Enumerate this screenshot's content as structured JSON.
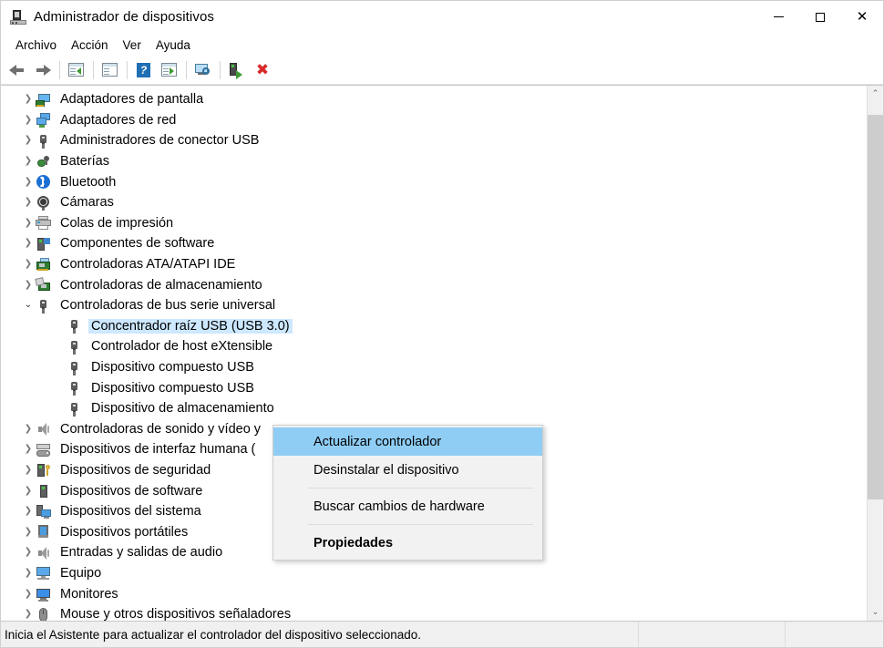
{
  "window": {
    "title": "Administrador de dispositivos",
    "icon": "device-manager-icon",
    "controls": {
      "minimize": "—",
      "maximize": "▢",
      "close": "✕"
    }
  },
  "menubar": {
    "items": [
      {
        "label": "Archivo",
        "name": "menu-archivo"
      },
      {
        "label": "Acción",
        "name": "menu-accion"
      },
      {
        "label": "Ver",
        "name": "menu-ver"
      },
      {
        "label": "Ayuda",
        "name": "menu-ayuda"
      }
    ]
  },
  "toolbar": {
    "buttons": [
      {
        "name": "back-button",
        "icon": "back-arrow-icon"
      },
      {
        "name": "forward-button",
        "icon": "forward-arrow-icon"
      },
      {
        "name": "show-hide-console-tree-button",
        "icon": "console-tree-icon"
      },
      {
        "name": "properties-button",
        "icon": "properties-window-icon"
      },
      {
        "name": "help-button",
        "icon": "help-question-icon"
      },
      {
        "name": "update-driver-button",
        "icon": "update-driver-icon"
      },
      {
        "name": "scan-hardware-changes-button",
        "icon": "scan-monitor-icon"
      },
      {
        "name": "uninstall-device-button",
        "icon": "uninstall-device-icon"
      },
      {
        "name": "disable-device-button",
        "icon": "red-x-icon"
      }
    ]
  },
  "tree": {
    "rows": [
      {
        "label": "Adaptadores de pantalla",
        "level": 1,
        "chevron": "collapsed",
        "icon": "display-adapter-icon",
        "icon_class": "i-disp",
        "selected": false
      },
      {
        "label": "Adaptadores de red",
        "level": 1,
        "chevron": "collapsed",
        "icon": "network-adapter-icon",
        "icon_class": "i-net",
        "selected": false
      },
      {
        "label": "Administradores de conector USB",
        "level": 1,
        "chevron": "collapsed",
        "icon": "usb-connector-icon",
        "icon_class": "i-usb",
        "selected": false
      },
      {
        "label": "Baterías",
        "level": 1,
        "chevron": "collapsed",
        "icon": "battery-icon",
        "icon_class": "i-bat",
        "selected": false
      },
      {
        "label": "Bluetooth",
        "level": 1,
        "chevron": "collapsed",
        "icon": "bluetooth-icon",
        "icon_class": "i-bt",
        "selected": false
      },
      {
        "label": "Cámaras",
        "level": 1,
        "chevron": "collapsed",
        "icon": "camera-icon",
        "icon_class": "i-cam",
        "selected": false
      },
      {
        "label": "Colas de impresión",
        "level": 1,
        "chevron": "collapsed",
        "icon": "printer-icon",
        "icon_class": "i-prn",
        "selected": false
      },
      {
        "label": "Componentes de software",
        "level": 1,
        "chevron": "collapsed",
        "icon": "software-component-icon",
        "icon_class": "i-swc",
        "selected": false
      },
      {
        "label": "Controladoras ATA/ATAPI IDE",
        "level": 1,
        "chevron": "collapsed",
        "icon": "ata-controller-icon",
        "icon_class": "i-ata",
        "selected": false
      },
      {
        "label": "Controladoras de almacenamiento",
        "level": 1,
        "chevron": "collapsed",
        "icon": "storage-controller-icon",
        "icon_class": "i-sto",
        "selected": false
      },
      {
        "label": "Controladoras de bus serie universal",
        "level": 1,
        "chevron": "expanded",
        "icon": "usb-controller-icon",
        "icon_class": "i-usb",
        "selected": false
      },
      {
        "label": "Concentrador raíz USB (USB 3.0)",
        "level": 2,
        "chevron": "none",
        "icon": "usb-device-icon",
        "icon_class": "i-usb",
        "selected": true
      },
      {
        "label": "Controlador de host eXtensible",
        "level": 2,
        "chevron": "none",
        "icon": "usb-device-icon",
        "icon_class": "i-usb",
        "selected": false
      },
      {
        "label": "Dispositivo compuesto USB",
        "level": 2,
        "chevron": "none",
        "icon": "usb-device-icon",
        "icon_class": "i-usb",
        "selected": false
      },
      {
        "label": "Dispositivo compuesto USB",
        "level": 2,
        "chevron": "none",
        "icon": "usb-device-icon",
        "icon_class": "i-usb",
        "selected": false
      },
      {
        "label": "Dispositivo de almacenamiento",
        "level": 2,
        "chevron": "none",
        "icon": "usb-device-icon",
        "icon_class": "i-usb",
        "selected": false
      },
      {
        "label": "Controladoras de sonido y vídeo y",
        "level": 1,
        "chevron": "collapsed",
        "icon": "sound-controller-icon",
        "icon_class": "i-spk",
        "selected": false
      },
      {
        "label": "Dispositivos de interfaz humana (",
        "level": 1,
        "chevron": "collapsed",
        "icon": "hid-icon",
        "icon_class": "i-hid",
        "selected": false
      },
      {
        "label": "Dispositivos de seguridad",
        "level": 1,
        "chevron": "collapsed",
        "icon": "security-device-icon",
        "icon_class": "i-sec",
        "selected": false
      },
      {
        "label": "Dispositivos de software",
        "level": 1,
        "chevron": "collapsed",
        "icon": "software-device-icon",
        "icon_class": "i-sw",
        "selected": false
      },
      {
        "label": "Dispositivos del sistema",
        "level": 1,
        "chevron": "collapsed",
        "icon": "system-device-icon",
        "icon_class": "i-sys",
        "selected": false
      },
      {
        "label": "Dispositivos portátiles",
        "level": 1,
        "chevron": "collapsed",
        "icon": "portable-device-icon",
        "icon_class": "i-port",
        "selected": false
      },
      {
        "label": "Entradas y salidas de audio",
        "level": 1,
        "chevron": "collapsed",
        "icon": "audio-io-icon",
        "icon_class": "i-spk",
        "selected": false
      },
      {
        "label": "Equipo",
        "level": 1,
        "chevron": "collapsed",
        "icon": "computer-icon",
        "icon_class": "i-eq",
        "selected": false
      },
      {
        "label": "Monitores",
        "level": 1,
        "chevron": "collapsed",
        "icon": "monitor-icon",
        "icon_class": "i-mon",
        "selected": false
      },
      {
        "label": "Mouse y otros dispositivos señaladores",
        "level": 1,
        "chevron": "collapsed",
        "icon": "mouse-icon",
        "icon_class": "i-mouse",
        "selected": false
      }
    ],
    "chevron_glyphs": {
      "collapsed": "❯",
      "expanded": "⌄"
    }
  },
  "context_menu": {
    "items": [
      {
        "label": "Actualizar controlador",
        "name": "ctx-update-driver",
        "highlighted": true,
        "bold": false
      },
      {
        "label": "Desinstalar el dispositivo",
        "name": "ctx-uninstall-device",
        "highlighted": false,
        "bold": false
      },
      {
        "separator_after": true
      },
      {
        "label": "Buscar cambios de hardware",
        "name": "ctx-scan-hardware-changes",
        "highlighted": false,
        "bold": false
      },
      {
        "separator_after": true
      },
      {
        "label": "Propiedades",
        "name": "ctx-properties",
        "highlighted": false,
        "bold": true
      }
    ],
    "highlight_color": "#8fcdf5"
  },
  "scrollbar": {
    "up_arrow": "⌃",
    "down_arrow": "⌄"
  },
  "statusbar": {
    "message": "Inicia el Asistente para actualizar el controlador del dispositivo seleccionado.",
    "pane2": "",
    "pane3": ""
  }
}
